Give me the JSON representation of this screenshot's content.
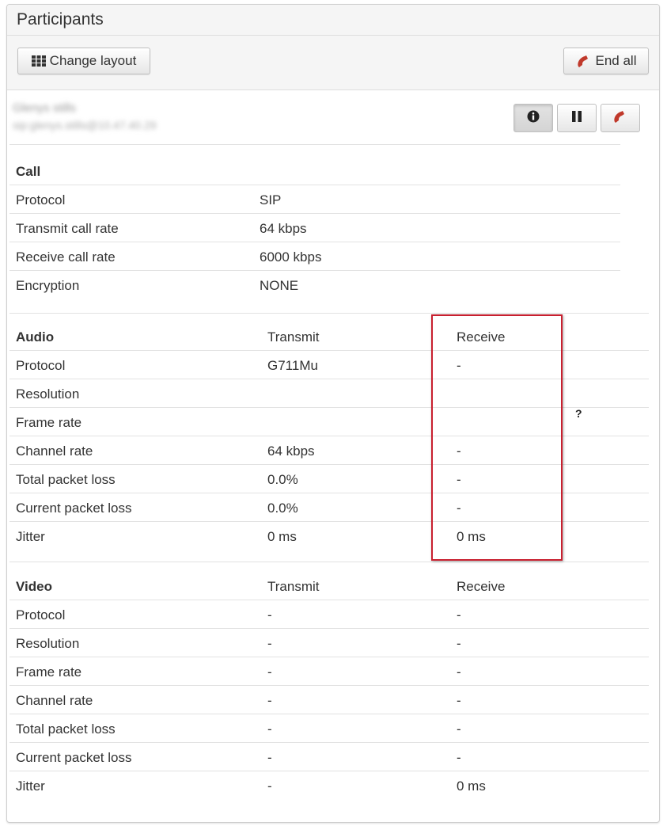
{
  "panel": {
    "title": "Participants"
  },
  "toolbar": {
    "change_layout_label": "Change layout",
    "end_all_label": "End all"
  },
  "participant": {
    "name": "Glenys stills",
    "uri": "sip:glenys.stills@10.47.40.29",
    "icons": [
      "info-icon",
      "pause-icon",
      "phone-hangup-icon"
    ]
  },
  "call": {
    "title": "Call",
    "rows": [
      {
        "label": "Protocol",
        "value": "SIP"
      },
      {
        "label": "Transmit call rate",
        "value": "64 kbps"
      },
      {
        "label": "Receive call rate",
        "value": "6000 kbps"
      },
      {
        "label": "Encryption",
        "value": "NONE"
      }
    ]
  },
  "audio": {
    "title": "Audio",
    "transmit_header": "Transmit",
    "receive_header": "Receive",
    "rows": [
      {
        "label": "Protocol",
        "transmit": "G711Mu",
        "receive": "-"
      },
      {
        "label": "Resolution",
        "transmit": "",
        "receive": ""
      },
      {
        "label": "Frame rate",
        "transmit": "",
        "receive": ""
      },
      {
        "label": "Channel rate",
        "transmit": "64 kbps",
        "receive": "-"
      },
      {
        "label": "Total packet loss",
        "transmit": "0.0%",
        "receive": "-"
      },
      {
        "label": "Current packet loss",
        "transmit": "0.0%",
        "receive": "-"
      },
      {
        "label": "Jitter",
        "transmit": "0 ms",
        "receive": "0 ms"
      }
    ]
  },
  "video": {
    "title": "Video",
    "transmit_header": "Transmit",
    "receive_header": "Receive",
    "rows": [
      {
        "label": "Protocol",
        "transmit": "-",
        "receive": "-"
      },
      {
        "label": "Resolution",
        "transmit": "-",
        "receive": "-"
      },
      {
        "label": "Frame rate",
        "transmit": "-",
        "receive": "-"
      },
      {
        "label": "Channel rate",
        "transmit": "-",
        "receive": "-"
      },
      {
        "label": "Total packet loss",
        "transmit": "-",
        "receive": "-"
      },
      {
        "label": "Current packet loss",
        "transmit": "-",
        "receive": "-"
      },
      {
        "label": "Jitter",
        "transmit": "-",
        "receive": "0 ms"
      }
    ]
  },
  "annotation": {
    "question_mark": "?"
  },
  "colors": {
    "highlight": "#c8202f",
    "hangup": "#c0392b"
  }
}
